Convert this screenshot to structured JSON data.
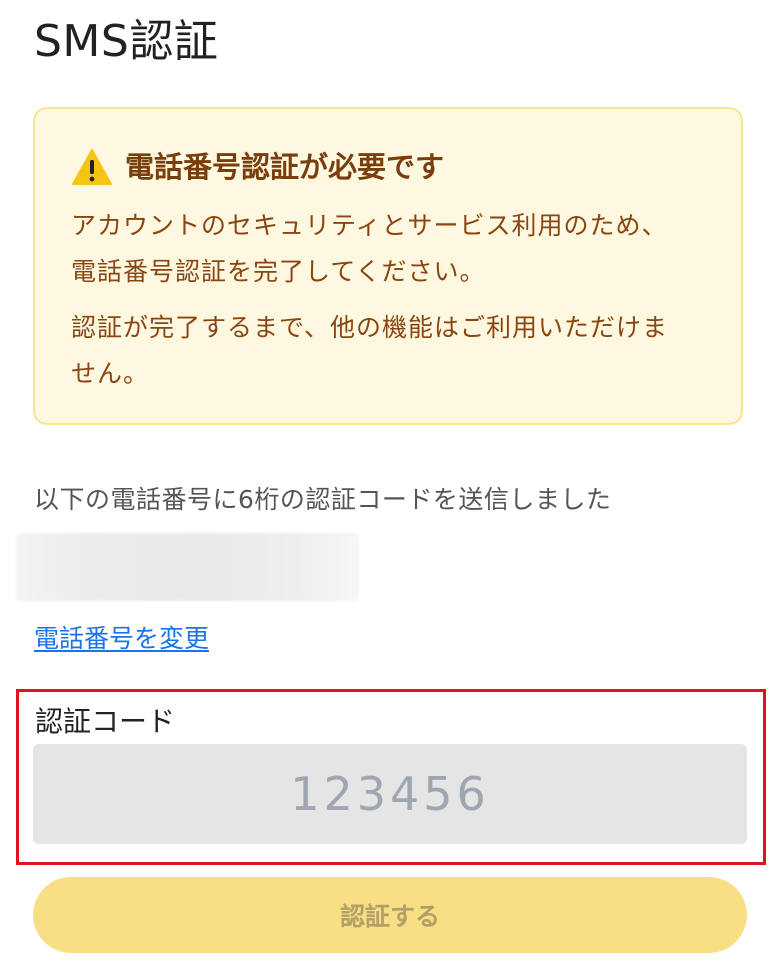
{
  "page": {
    "title": "SMS認証"
  },
  "notice": {
    "icon": "warning-icon",
    "title": "電話番号認証が必要です",
    "line1": "アカウントのセキュリティとサービス利用のため、",
    "line2": "電話番号認証を完了してください。",
    "line3": "認証が完了するまで、他の機能はご利用いただけま",
    "line4": "せん。",
    "colors": {
      "background": "#fef8e1",
      "border": "#f7e58f",
      "title": "#7a3e0c",
      "text": "#8a4612"
    }
  },
  "verification": {
    "sent_message": "以下の電話番号に6桁の認証コードを送信しました",
    "change_phone_link": "電話番号を変更",
    "code_label": "認証コード",
    "code_value": "",
    "code_placeholder": "123456",
    "submit_label": "認証する"
  },
  "colors": {
    "link": "#1a73e8",
    "highlight_border": "#e0131b",
    "button_bg": "#f8df85",
    "button_text": "#b3a068"
  }
}
